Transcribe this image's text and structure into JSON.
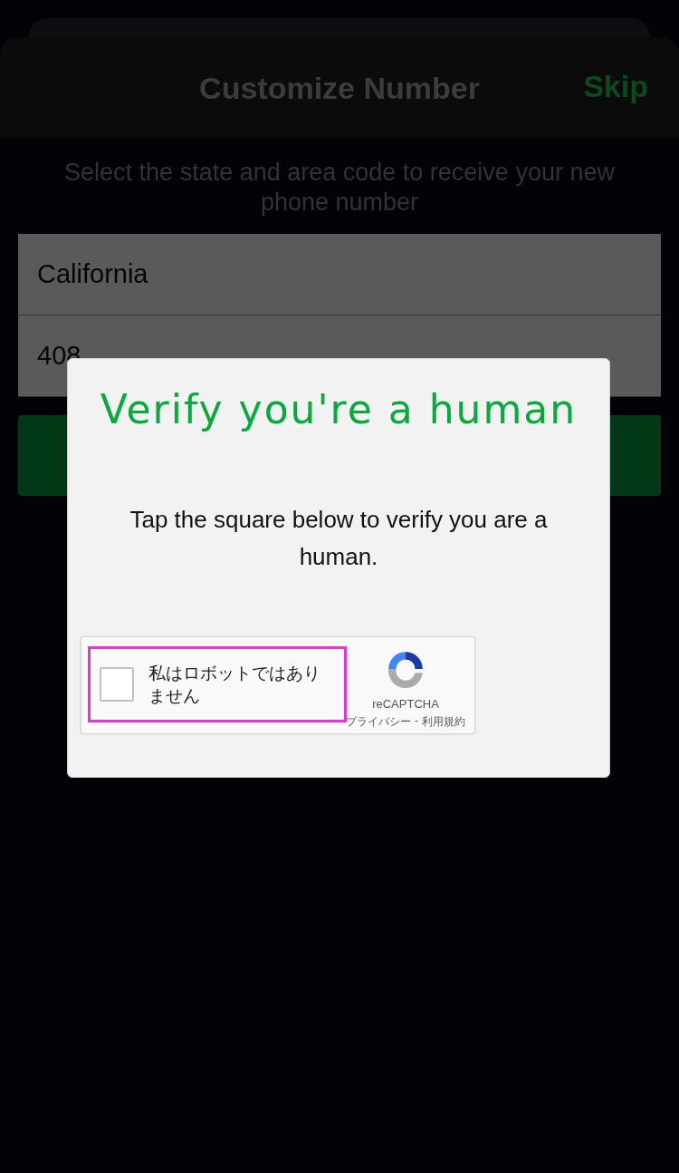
{
  "header": {
    "title": "Customize Number",
    "skip": "Skip"
  },
  "instruction": "Select the state and area code to receive your new phone number",
  "fields": [
    {
      "value": "California"
    },
    {
      "value": "408"
    }
  ],
  "dialog": {
    "title": "Verify you're a human",
    "message": "Tap the square below to verify you are a human.",
    "captcha": {
      "checked": false,
      "label": "私はロボットではありません",
      "brand": "reCAPTCHA",
      "privacy": "プライバシー",
      "separator": "-",
      "terms": "利用規約"
    }
  }
}
